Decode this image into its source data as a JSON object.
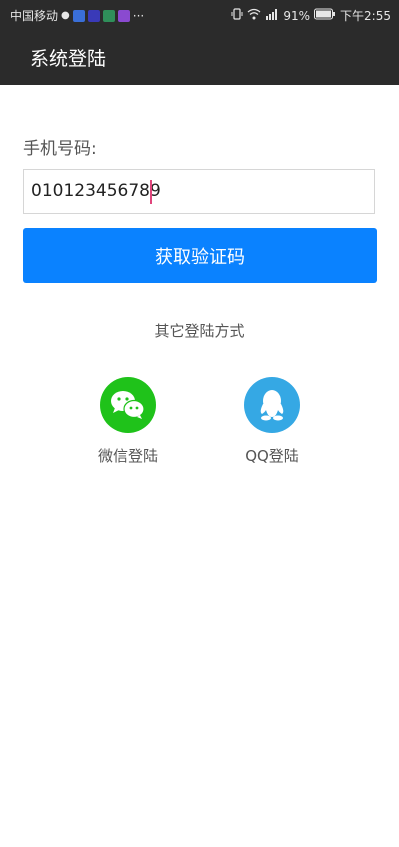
{
  "status_bar": {
    "carrier": "中国移动",
    "more": "···",
    "battery": "91%",
    "time": "下午2:55"
  },
  "app_bar": {
    "title": "系统登陆"
  },
  "form": {
    "phone_label": "手机号码:",
    "phone_value": "010123456789",
    "get_code_button": "获取验证码"
  },
  "other_login": {
    "heading": "其它登陆方式",
    "wechat_label": "微信登陆",
    "qq_label": "QQ登陆"
  },
  "colors": {
    "primary": "#0a82ff",
    "wechat": "#1fc21a",
    "qq": "#35a8e4",
    "appbar": "#2b2b2b"
  }
}
